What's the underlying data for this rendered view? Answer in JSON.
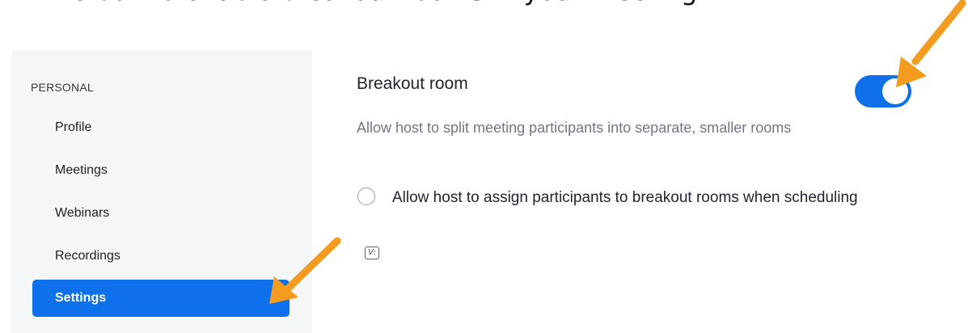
{
  "caption": "the box to enable breakout rooms in your meeting",
  "sidebar": {
    "section": "PERSONAL",
    "items": [
      {
        "label": "Profile",
        "active": false
      },
      {
        "label": "Meetings",
        "active": false
      },
      {
        "label": "Webinars",
        "active": false
      },
      {
        "label": "Recordings",
        "active": false
      },
      {
        "label": "Settings",
        "active": true
      }
    ]
  },
  "setting": {
    "title": "Breakout room",
    "description": "Allow host to split meeting participants into separate, smaller rooms",
    "toggle_on": true,
    "option_label": "Allow host to assign participants to breakout rooms when scheduling",
    "option_checked": false,
    "info_icon": "v-info-icon"
  },
  "colors": {
    "accent": "#0e71eb",
    "arrow": "#f39c1f",
    "sidebar_bg": "#f5f6f7"
  }
}
